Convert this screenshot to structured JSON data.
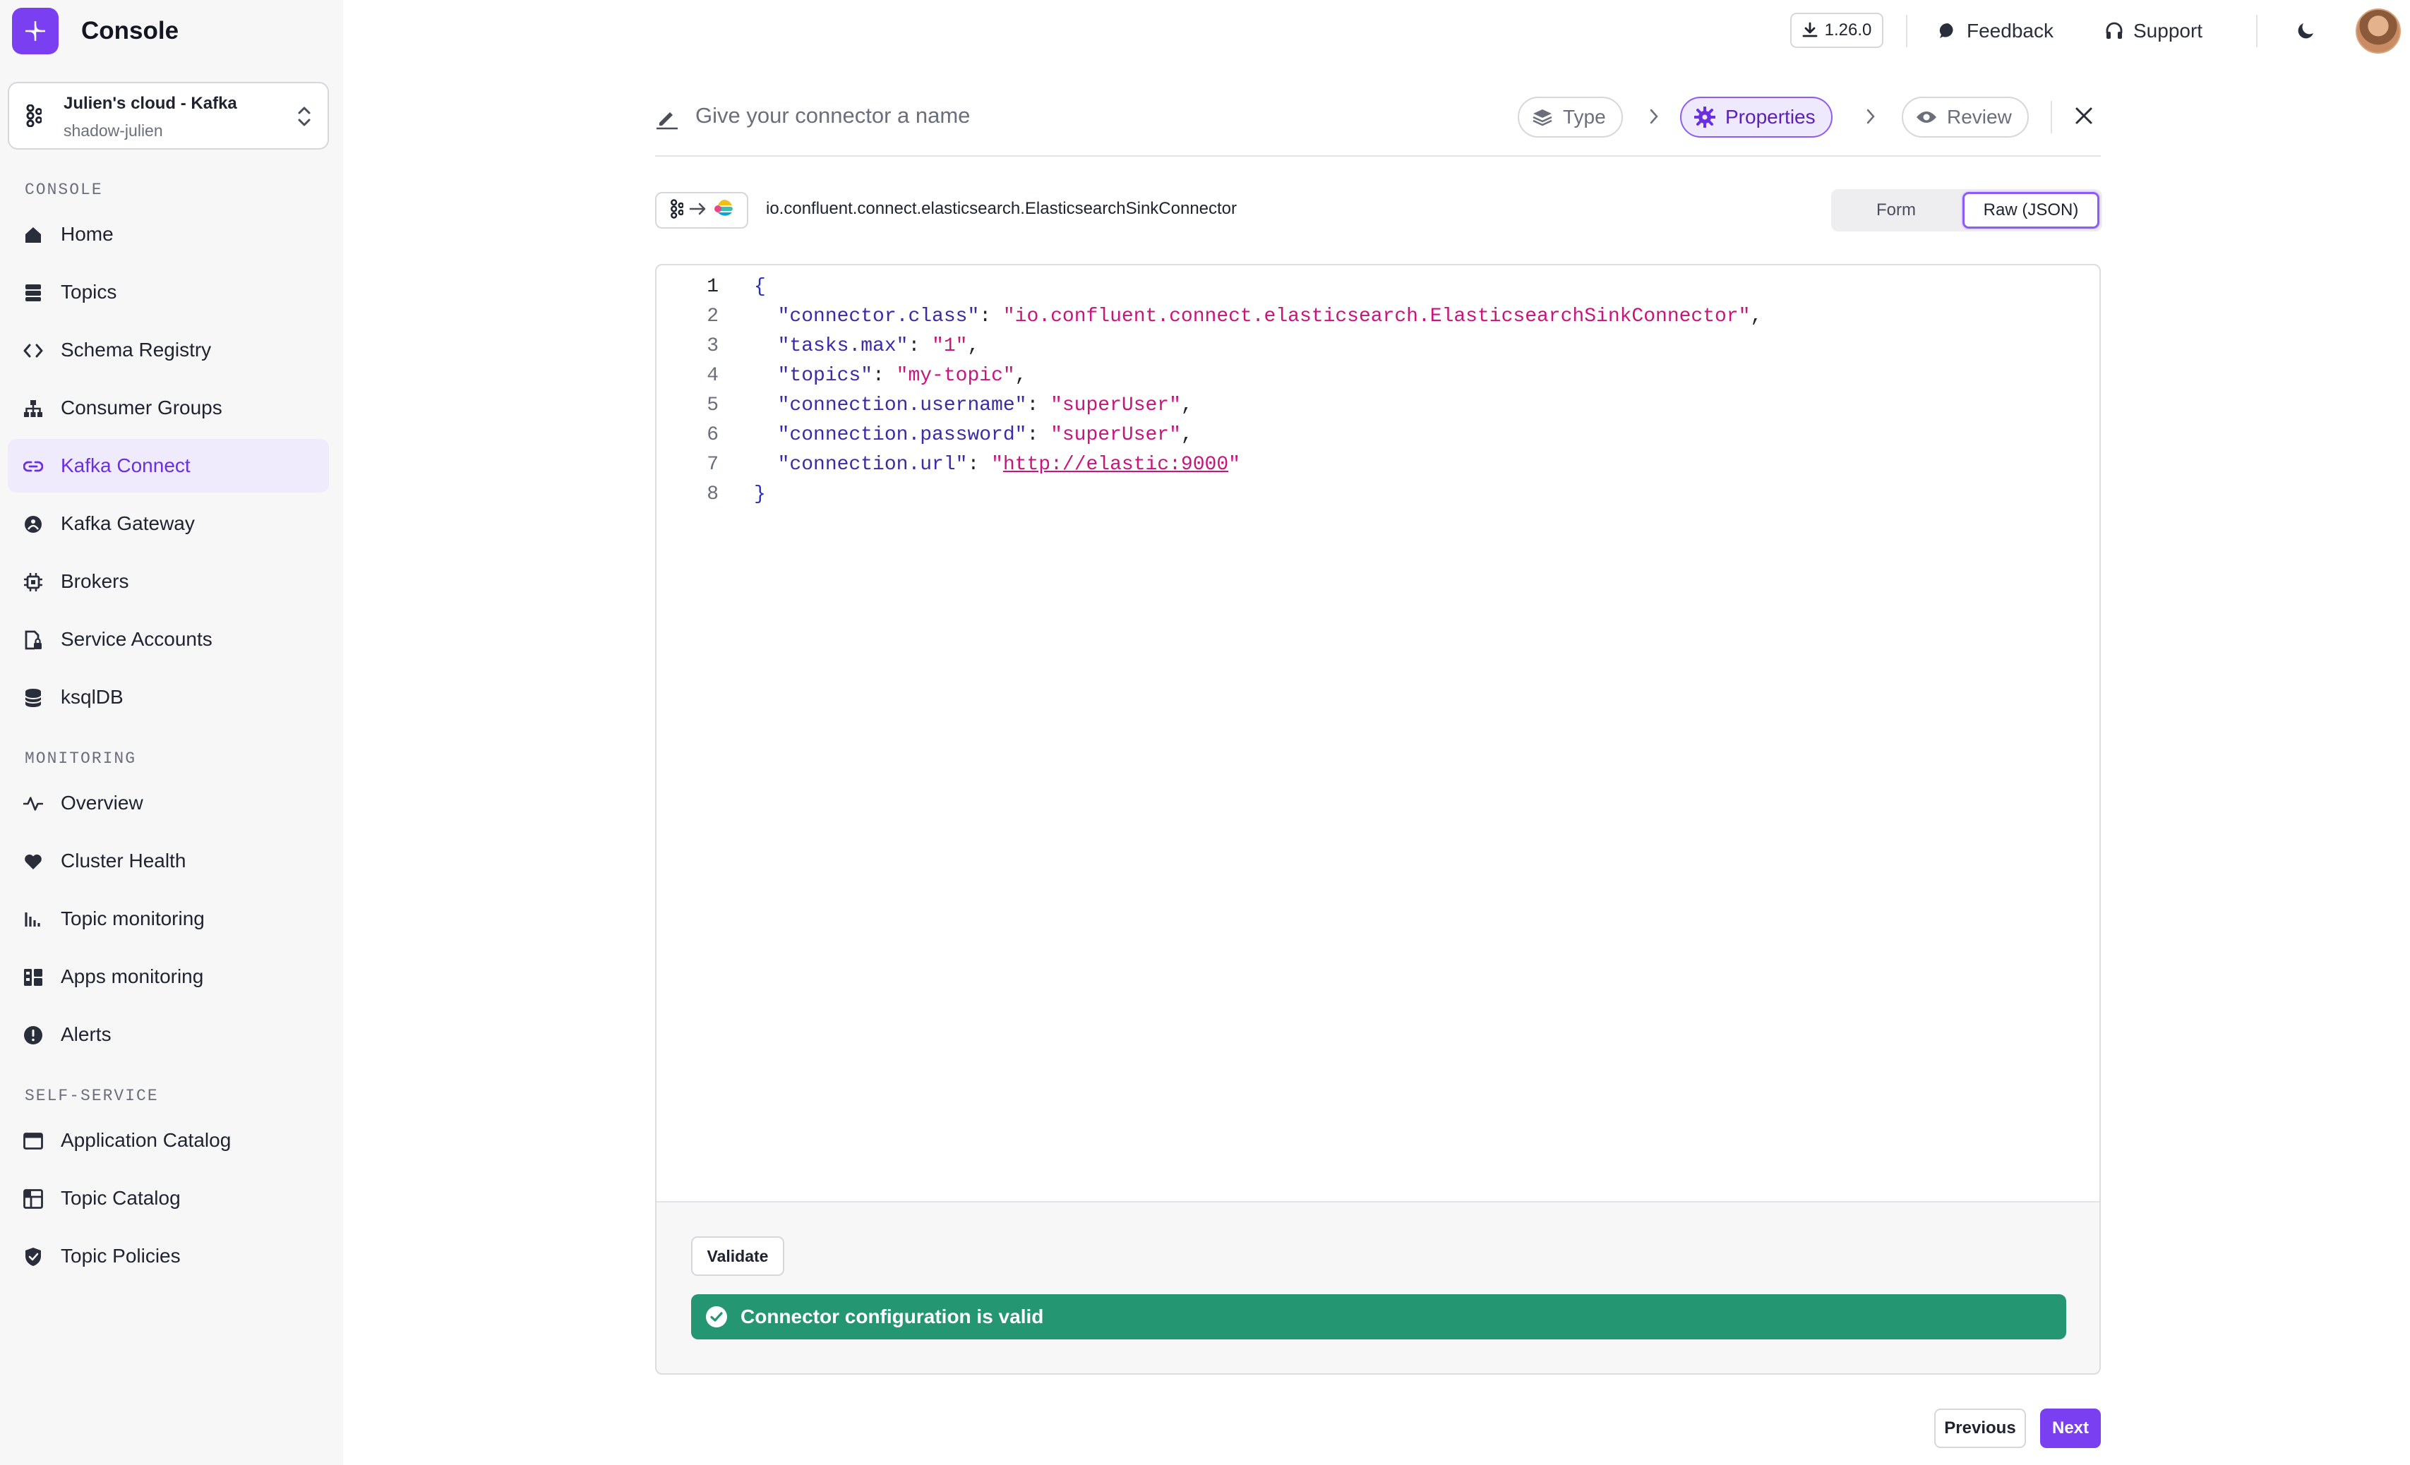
{
  "app": {
    "title": "Console",
    "logo_icon": "console-logo-icon",
    "accent_color": "#7b3ff2"
  },
  "cluster": {
    "name": "Julien's cloud - Kafka",
    "subtitle": "shadow-julien"
  },
  "sidebar": {
    "sections": [
      {
        "label": "CONSOLE",
        "items": [
          {
            "label": "Home",
            "icon": "home-icon"
          },
          {
            "label": "Topics",
            "icon": "topics-icon"
          },
          {
            "label": "Schema Registry",
            "icon": "code-icon"
          },
          {
            "label": "Consumer Groups",
            "icon": "hierarchy-icon"
          },
          {
            "label": "Kafka Connect",
            "icon": "link-icon",
            "active": true
          },
          {
            "label": "Kafka Gateway",
            "icon": "gateway-icon"
          },
          {
            "label": "Brokers",
            "icon": "cpu-icon"
          },
          {
            "label": "Service Accounts",
            "icon": "file-lock-icon"
          },
          {
            "label": "ksqlDB",
            "icon": "database-icon"
          }
        ]
      },
      {
        "label": "MONITORING",
        "items": [
          {
            "label": "Overview",
            "icon": "activity-icon"
          },
          {
            "label": "Cluster Health",
            "icon": "heart-icon"
          },
          {
            "label": "Topic monitoring",
            "icon": "bar-chart-icon"
          },
          {
            "label": "Apps monitoring",
            "icon": "layout-icon"
          },
          {
            "label": "Alerts",
            "icon": "alert-icon"
          }
        ]
      },
      {
        "label": "SELF-SERVICE",
        "items": [
          {
            "label": "Application Catalog",
            "icon": "browser-icon"
          },
          {
            "label": "Topic Catalog",
            "icon": "catalog-icon"
          },
          {
            "label": "Topic Policies",
            "icon": "shield-icon"
          }
        ]
      }
    ]
  },
  "topbar": {
    "version": "1.26.0",
    "feedback": "Feedback",
    "support": "Support"
  },
  "wizard": {
    "name_placeholder": "Give your connector a name",
    "steps": [
      {
        "label": "Type",
        "icon": "layers-icon"
      },
      {
        "label": "Properties",
        "icon": "gear-icon",
        "active": true
      },
      {
        "label": "Review",
        "icon": "eye-icon"
      }
    ]
  },
  "connector": {
    "class": "io.confluent.connect.elasticsearch.ElasticsearchSinkConnector"
  },
  "view_toggle": {
    "form": "Form",
    "raw": "Raw (JSON)",
    "selected": "raw"
  },
  "editor": {
    "lines": [
      {
        "num": "1",
        "current": true,
        "tokens": [
          {
            "t": "{",
            "c": "b"
          }
        ]
      },
      {
        "num": "2",
        "tokens": [
          {
            "t": "  "
          },
          {
            "t": "\"connector.class\"",
            "c": "k"
          },
          {
            "t": ": ",
            "c": "p"
          },
          {
            "t": "\"io.confluent.connect.elasticsearch.ElasticsearchSinkConnector\"",
            "c": "s"
          },
          {
            "t": ",",
            "c": "p"
          }
        ]
      },
      {
        "num": "3",
        "tokens": [
          {
            "t": "  "
          },
          {
            "t": "\"tasks.max\"",
            "c": "k"
          },
          {
            "t": ": ",
            "c": "p"
          },
          {
            "t": "\"1\"",
            "c": "s"
          },
          {
            "t": ",",
            "c": "p"
          }
        ]
      },
      {
        "num": "4",
        "tokens": [
          {
            "t": "  "
          },
          {
            "t": "\"topics\"",
            "c": "k"
          },
          {
            "t": ": ",
            "c": "p"
          },
          {
            "t": "\"my-topic\"",
            "c": "s"
          },
          {
            "t": ",",
            "c": "p"
          }
        ]
      },
      {
        "num": "5",
        "tokens": [
          {
            "t": "  "
          },
          {
            "t": "\"connection.username\"",
            "c": "k"
          },
          {
            "t": ": ",
            "c": "p"
          },
          {
            "t": "\"superUser\"",
            "c": "s"
          },
          {
            "t": ",",
            "c": "p"
          }
        ]
      },
      {
        "num": "6",
        "tokens": [
          {
            "t": "  "
          },
          {
            "t": "\"connection.password\"",
            "c": "k"
          },
          {
            "t": ": ",
            "c": "p"
          },
          {
            "t": "\"superUser\"",
            "c": "s"
          },
          {
            "t": ",",
            "c": "p"
          }
        ]
      },
      {
        "num": "7",
        "tokens": [
          {
            "t": "  "
          },
          {
            "t": "\"connection.url\"",
            "c": "k"
          },
          {
            "t": ": ",
            "c": "p"
          },
          {
            "t": "\"",
            "c": "s"
          },
          {
            "t": "http://elastic:9000",
            "c": "s u"
          },
          {
            "t": "\"",
            "c": "s"
          }
        ]
      },
      {
        "num": "8",
        "tokens": [
          {
            "t": "}",
            "c": "b"
          }
        ]
      }
    ]
  },
  "validation": {
    "button": "Validate",
    "message": "Connector configuration is valid",
    "status_color": "#249672"
  },
  "nav_buttons": {
    "previous": "Previous",
    "next": "Next"
  }
}
